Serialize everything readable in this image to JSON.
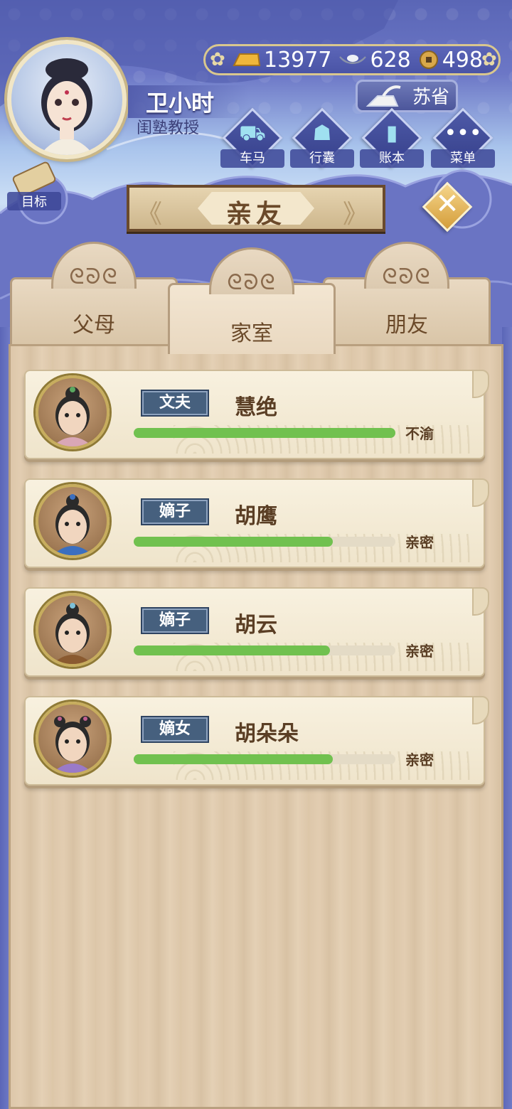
{
  "player": {
    "name": "卫小时",
    "title": "闺塾教授"
  },
  "currency": {
    "gold": "13977",
    "silver": "628",
    "coins": "498"
  },
  "location": {
    "label": "苏省"
  },
  "menu": [
    {
      "label": "车马",
      "icon": "carriage-icon"
    },
    {
      "label": "行囊",
      "icon": "bag-icon"
    },
    {
      "label": "账本",
      "icon": "ledger-icon"
    },
    {
      "label": "菜单",
      "icon": "more-icon"
    }
  ],
  "goal": {
    "label": "目标"
  },
  "panel": {
    "title": "亲友"
  },
  "tabs": [
    {
      "label": "父母",
      "active": false
    },
    {
      "label": "家室",
      "active": true
    },
    {
      "label": "朋友",
      "active": false
    }
  ],
  "members": [
    {
      "relation": "文夫",
      "name": "慧绝",
      "status": "不渝",
      "affinity": 1.0
    },
    {
      "relation": "嫡子",
      "name": "胡鹰",
      "status": "亲密",
      "affinity": 0.76
    },
    {
      "relation": "嫡子",
      "name": "胡云",
      "status": "亲密",
      "affinity": 0.75
    },
    {
      "relation": "嫡女",
      "name": "胡朵朵",
      "status": "亲密",
      "affinity": 0.76
    }
  ],
  "colors": {
    "bar": "#71c14f",
    "badge": "#46607e",
    "wood": "#ddc7aa",
    "sky": "#5a66b6"
  }
}
